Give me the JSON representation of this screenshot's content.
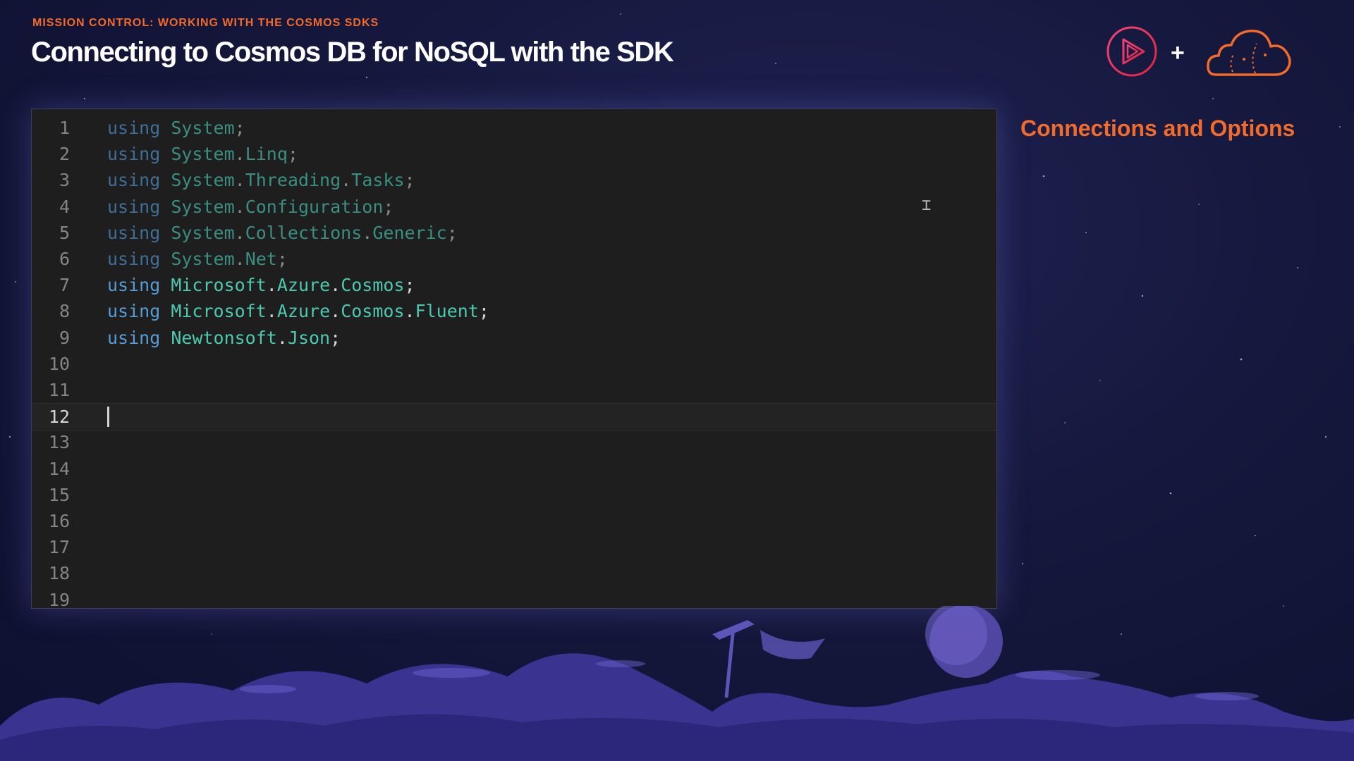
{
  "slide": {
    "eyebrow": "MISSION CONTROL: WORKING WITH THE COSMOS SDKS",
    "title": "Connecting to Cosmos DB for NoSQL with the SDK",
    "side_title": "Connections and Options"
  },
  "logos": {
    "play_icon": "pluralsight-play-icon",
    "plus": "+",
    "cloud_icon": "cloud-icon"
  },
  "colors": {
    "accent": "#f26b2a",
    "background": "#15183c",
    "editor_bg": "#1e1e1e",
    "keyword": "#569cd6",
    "namespace": "#4ec9b0"
  },
  "editor": {
    "current_line": 12,
    "lines": [
      {
        "n": "1",
        "kw": "using",
        "parts": [
          "System"
        ],
        "end": ";",
        "faded": true
      },
      {
        "n": "2",
        "kw": "using",
        "parts": [
          "System",
          "Linq"
        ],
        "end": ";",
        "faded": true
      },
      {
        "n": "3",
        "kw": "using",
        "parts": [
          "System",
          "Threading",
          "Tasks"
        ],
        "end": ";",
        "faded": true
      },
      {
        "n": "4",
        "kw": "using",
        "parts": [
          "System",
          "Configuration"
        ],
        "end": ";",
        "faded": true
      },
      {
        "n": "5",
        "kw": "using",
        "parts": [
          "System",
          "Collections",
          "Generic"
        ],
        "end": ";",
        "faded": true
      },
      {
        "n": "6",
        "kw": "using",
        "parts": [
          "System",
          "Net"
        ],
        "end": ";",
        "faded": true
      },
      {
        "n": "7",
        "kw": "using",
        "parts": [
          "Microsoft",
          "Azure",
          "Cosmos"
        ],
        "end": ";",
        "faded": false
      },
      {
        "n": "8",
        "kw": "using",
        "parts": [
          "Microsoft",
          "Azure",
          "Cosmos",
          "Fluent"
        ],
        "end": ";",
        "faded": false
      },
      {
        "n": "9",
        "kw": "using",
        "parts": [
          "Newtonsoft",
          "Json"
        ],
        "end": ";",
        "faded": false
      },
      {
        "n": "10"
      },
      {
        "n": "11"
      },
      {
        "n": "12"
      },
      {
        "n": "13"
      },
      {
        "n": "14"
      },
      {
        "n": "15"
      },
      {
        "n": "16"
      },
      {
        "n": "17"
      },
      {
        "n": "18"
      },
      {
        "n": "19"
      }
    ]
  }
}
